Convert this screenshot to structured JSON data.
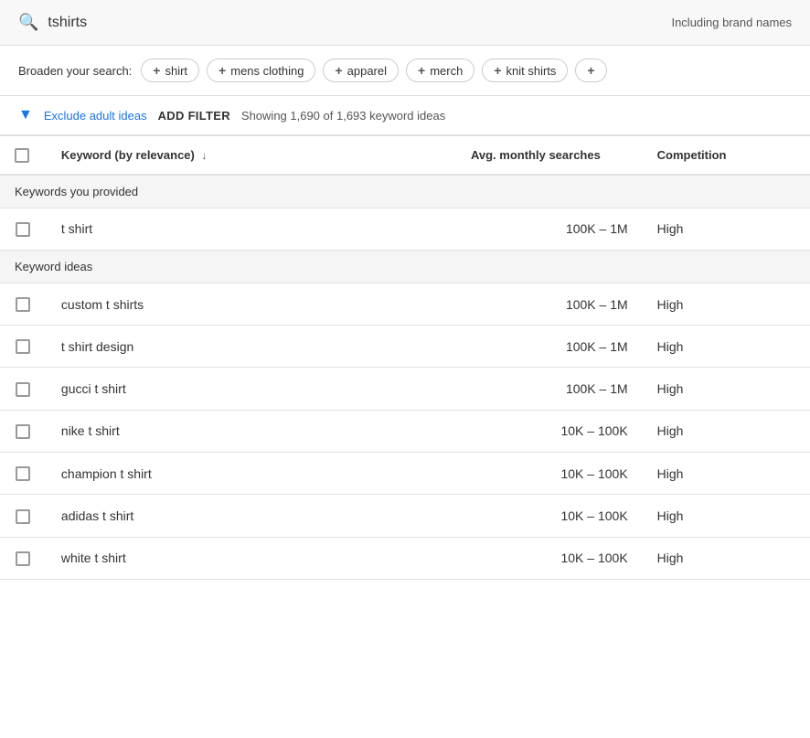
{
  "searchBar": {
    "query": "tshirts",
    "brandNamesLabel": "Including brand names",
    "searchIconLabel": "search-icon"
  },
  "broadenSearch": {
    "label": "Broaden your search:",
    "tags": [
      {
        "id": "shirt",
        "label": "shirt"
      },
      {
        "id": "mens-clothing",
        "label": "mens clothing"
      },
      {
        "id": "apparel",
        "label": "apparel"
      },
      {
        "id": "merch",
        "label": "merch"
      },
      {
        "id": "knit-shirts",
        "label": "knit shirts"
      },
      {
        "id": "more",
        "label": "+"
      }
    ]
  },
  "filterBar": {
    "excludeAdultLabel": "Exclude adult ideas",
    "addFilterLabel": "ADD FILTER",
    "showingText": "Showing 1,690 of 1,693 keyword ideas"
  },
  "table": {
    "headers": {
      "keyword": "Keyword (by relevance)",
      "searches": "Avg. monthly searches",
      "competition": "Competition"
    },
    "sections": [
      {
        "title": "Keywords you provided",
        "rows": [
          {
            "keyword": "t shirt",
            "searches": "100K – 1M",
            "competition": "High"
          }
        ]
      },
      {
        "title": "Keyword ideas",
        "rows": [
          {
            "keyword": "custom t shirts",
            "searches": "100K – 1M",
            "competition": "High"
          },
          {
            "keyword": "t shirt design",
            "searches": "100K – 1M",
            "competition": "High"
          },
          {
            "keyword": "gucci t shirt",
            "searches": "100K – 1M",
            "competition": "High"
          },
          {
            "keyword": "nike t shirt",
            "searches": "10K – 100K",
            "competition": "High"
          },
          {
            "keyword": "champion t shirt",
            "searches": "10K – 100K",
            "competition": "High"
          },
          {
            "keyword": "adidas t shirt",
            "searches": "10K – 100K",
            "competition": "High"
          },
          {
            "keyword": "white t shirt",
            "searches": "10K – 100K",
            "competition": "High"
          }
        ]
      }
    ]
  }
}
